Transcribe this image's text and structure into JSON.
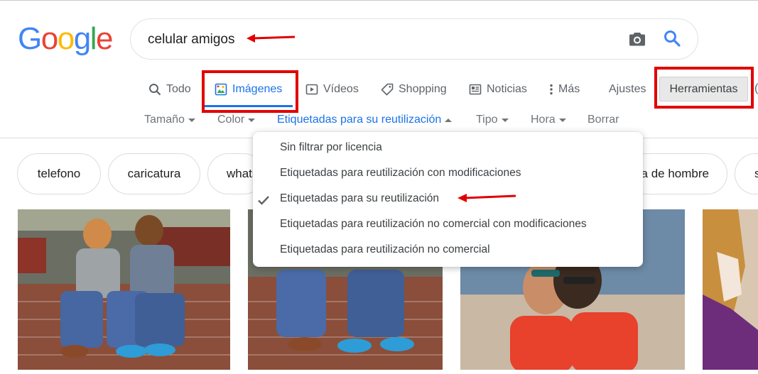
{
  "logo": {
    "letters": [
      "G",
      "o",
      "o",
      "g",
      "l",
      "e"
    ],
    "colors": [
      "#4285f4",
      "#ea4335",
      "#fbbc05",
      "#4285f4",
      "#34a853",
      "#ea4335"
    ]
  },
  "search": {
    "query": "celular amigos"
  },
  "icons": {
    "camera": "camera-icon",
    "search": "search-icon"
  },
  "tabs": {
    "todo": "Todo",
    "imagenes": "Imágenes",
    "videos": "Vídeos",
    "shopping": "Shopping",
    "noticias": "Noticias",
    "mas": "Más",
    "ajustes": "Ajustes",
    "herramientas": "Herramientas",
    "cut_char": "("
  },
  "filters": {
    "tamano": "Tamaño",
    "color": "Color",
    "licencia": "Etiquetadas para su reutilización",
    "tipo": "Tipo",
    "hora": "Hora",
    "borrar": "Borrar"
  },
  "chips": [
    "telefono",
    "caricatura",
    "whats",
    "a de hombre",
    "s"
  ],
  "dropdown": {
    "items": [
      "Sin filtrar por licencia",
      "Etiquetadas para reutilización con modificaciones",
      "Etiquetadas para su reutilización",
      "Etiquetadas para reutilización no comercial con modificaciones",
      "Etiquetadas para reutilización no comercial"
    ],
    "selected_index": 2
  },
  "colors": {
    "accent": "#1a73e8",
    "annotation_red": "#e10000",
    "tools_bg": "#e8e8e8"
  }
}
